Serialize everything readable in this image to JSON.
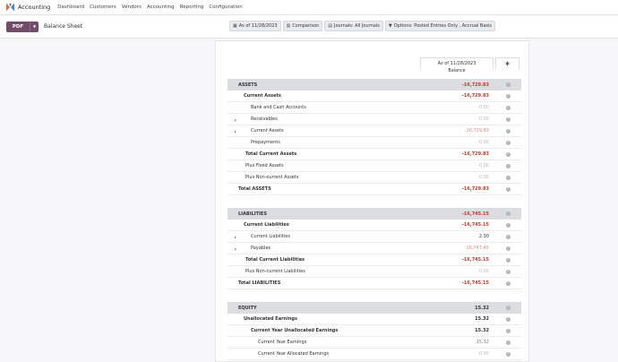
{
  "navbar": {
    "app_name": "Accounting",
    "items": [
      "Dashboard",
      "Customers",
      "Vendors",
      "Accounting",
      "Reporting",
      "Configuration"
    ]
  },
  "control": {
    "pdf_label": "PDF",
    "breadcrumb": "Balance Sheet",
    "filters": {
      "date": "As of 11/28/2023",
      "comparison": "Comparison",
      "journals": "Journals: All Journals",
      "options": "Options: Posted Entries Only , Accrual Basis"
    }
  },
  "report": {
    "column_date": "As of 11/28/2023",
    "column_balance": "Balance",
    "rows": [
      {
        "label": "ASSETS",
        "value": "-16,729.83"
      },
      {
        "label": "Current Assets",
        "value": "-16,729.83"
      },
      {
        "label": "Bank and Cash Accounts",
        "value": "0.00"
      },
      {
        "label": "Receivables",
        "value": "0.00"
      },
      {
        "label": "Current Assets",
        "value": "-16,729.83"
      },
      {
        "label": "Prepayments",
        "value": "0.00"
      },
      {
        "label": "Total Current Assets",
        "value": "-16,729.83"
      },
      {
        "label": "Plus Fixed Assets",
        "value": "0.00"
      },
      {
        "label": "Plus Non-current Assets",
        "value": "0.00"
      },
      {
        "label": "Total ASSETS",
        "value": "-16,729.83"
      },
      {
        "label": "LIABILITIES",
        "value": "-16,745.15"
      },
      {
        "label": "Current Liabilities",
        "value": "-16,745.15"
      },
      {
        "label": "Current Liabilities",
        "value": "2.30"
      },
      {
        "label": "Payables",
        "value": "-16,747.45"
      },
      {
        "label": "Total Current Liabilities",
        "value": "-16,745.15"
      },
      {
        "label": "Plus Non-current Liabilities",
        "value": "0.00"
      },
      {
        "label": "Total LIABILITIES",
        "value": "-16,745.15"
      },
      {
        "label": "EQUITY",
        "value": "15.32"
      },
      {
        "label": "Unallocated Earnings",
        "value": "15.32"
      },
      {
        "label": "Current Year Unallocated Earnings",
        "value": "15.32"
      },
      {
        "label": "Current Year Earnings",
        "value": "15.32"
      },
      {
        "label": "Current Year Allocated Earnings",
        "value": "0.00"
      }
    ]
  }
}
